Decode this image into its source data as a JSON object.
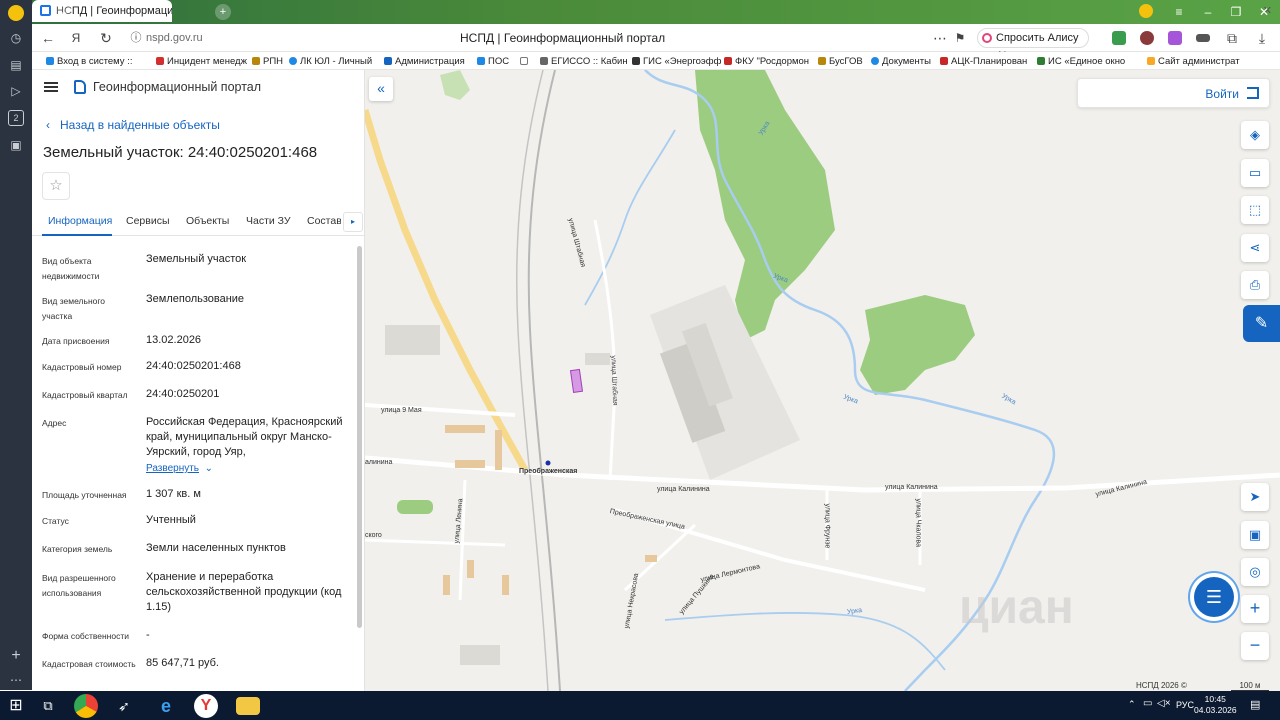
{
  "browser": {
    "tab_count": "1",
    "tab_title": "НСПД | Геоинформаци",
    "url": "nspd.gov.ru",
    "page_title": "НСПД | Геоинформационный портал",
    "alice_label": "Спросить Алису AI",
    "bookmarks": [
      "Вход в систему ::",
      "Инцидент менедж",
      "РПН",
      "ЛК ЮЛ - Личный",
      "Администрация",
      "ПОС",
      "ЕГИССО :: Кабин",
      "ГИС «Энергоэфф",
      "ФКУ \"Росдормон",
      "БусГОВ",
      "Документы",
      "АЦК-Планирован",
      "ИС «Единое окно",
      "Сайт администрат"
    ]
  },
  "panel": {
    "portal_name": "Геоинформационный портал",
    "back_link": "Назад в найденные объекты",
    "object_title": "Земельный участок: 24:40:0250201:468",
    "tabs": [
      "Информация",
      "Сервисы",
      "Объекты",
      "Части ЗУ",
      "Состав"
    ],
    "fields": [
      {
        "label": "Вид объекта недвижимости",
        "value": "Земельный участок"
      },
      {
        "label": "Вид земельного участка",
        "value": "Землепользование"
      },
      {
        "label": "Дата присвоения",
        "value": "13.02.2026"
      },
      {
        "label": "Кадастровый номер",
        "value": "24:40:0250201:468"
      },
      {
        "label": "Кадастровый квартал",
        "value": "24:40:0250201"
      },
      {
        "label": "Адрес",
        "value": "Российская Федерация, Красноярский край, муниципальный округ Манско-Уярский, город Уяр,"
      },
      {
        "label": "Площадь уточненная",
        "value": "1 307 кв. м"
      },
      {
        "label": "Статус",
        "value": "Учтенный"
      },
      {
        "label": "Категория земель",
        "value": "Земли населенных пунктов"
      },
      {
        "label": "Вид разрешенного использования",
        "value": "Хранение и переработка сельскохозяйственной продукции (код 1.15)"
      },
      {
        "label": "Форма собственности",
        "value": "-"
      },
      {
        "label": "Кадастровая стоимость",
        "value": "85 647,71 руб."
      }
    ],
    "expand_link": "Развернуть"
  },
  "map": {
    "login_label": "Войти",
    "copyright": "НСПД 2026 ©",
    "scale": "100 м",
    "watermark": "циан",
    "streets": [
      "улица 9 Мая",
      "улица Штабная",
      "улица Штабная",
      "Преображенская",
      "улица Калинина",
      "улица Калинина",
      "улица Калинина",
      "Преображенская улица",
      "улица Ленина",
      "улица Лермонтова",
      "улица Пушкина",
      "улица Некрасова",
      "улица Фрунзе",
      "улица Чкалова",
      "Урка",
      "Урка",
      "Урка",
      "Урка",
      "Урка",
      "алинина",
      "ского"
    ]
  },
  "taskbar": {
    "lang": "РУС",
    "time": "10:45",
    "date": "04.03.2026"
  }
}
